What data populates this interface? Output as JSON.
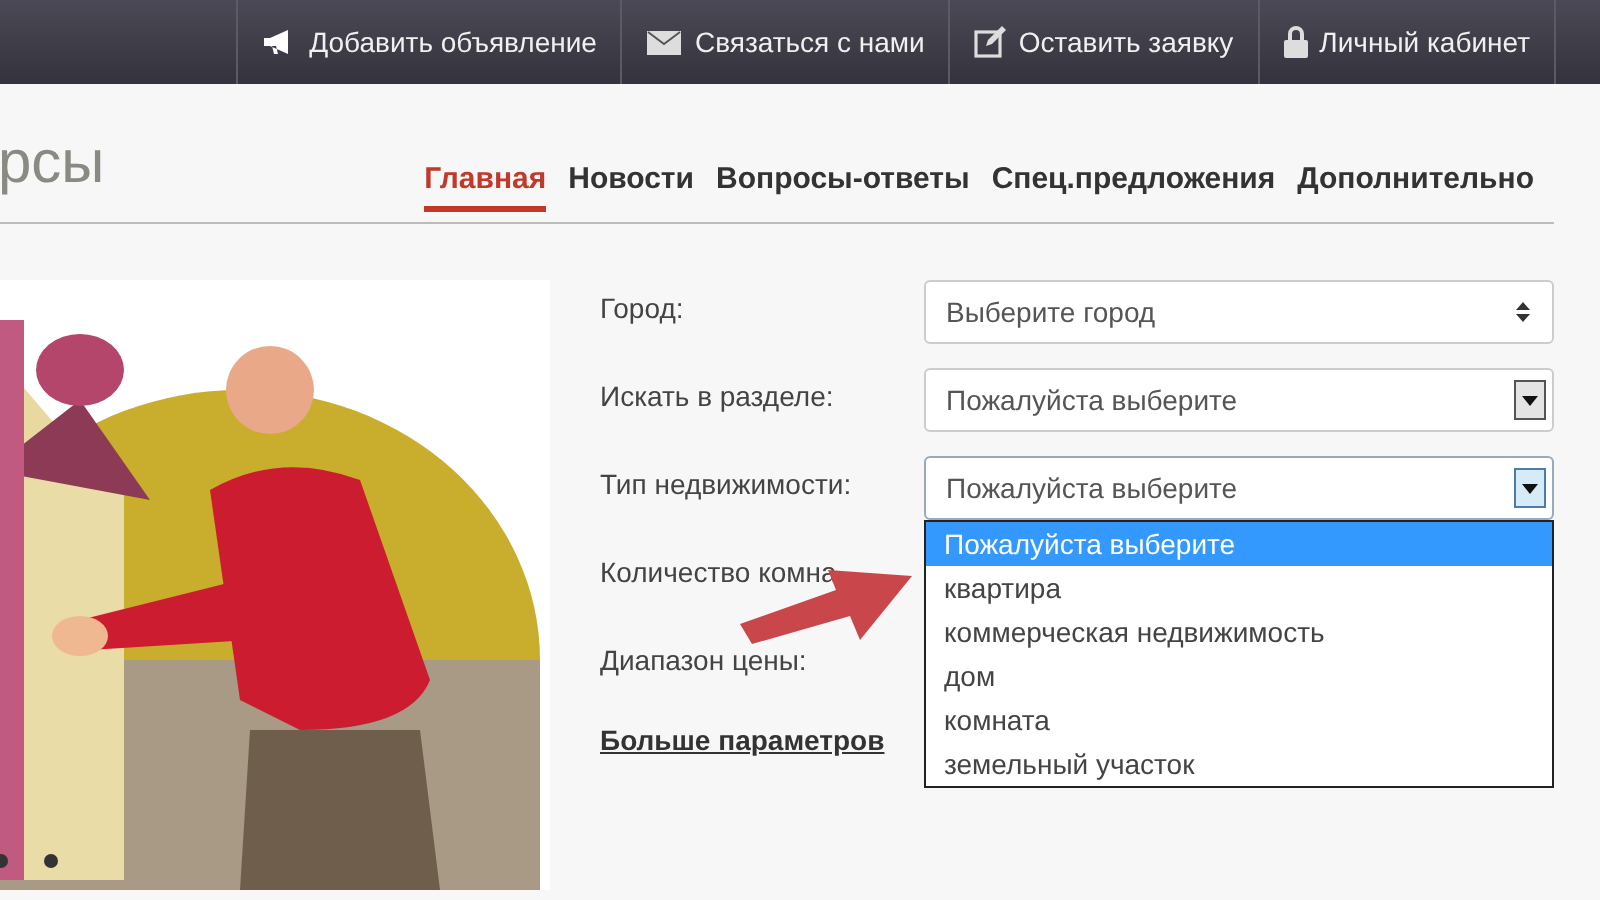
{
  "top_bar": {
    "items": [
      {
        "kind": "megaphone",
        "label": "Добавить объявление"
      },
      {
        "kind": "envelope",
        "label": "Связаться с нами"
      },
      {
        "kind": "edit",
        "label": "Оставить заявку"
      },
      {
        "kind": "lock",
        "label": "Личный кабинет"
      }
    ]
  },
  "logo": {
    "text": "рсы"
  },
  "nav": {
    "tabs": [
      {
        "label": "Главная",
        "selected": true
      },
      {
        "label": "Новости",
        "selected": false
      },
      {
        "label": "Вопросы-ответы",
        "selected": false
      },
      {
        "label": "Спец.предложения",
        "selected": false
      },
      {
        "label": "Дополнительно",
        "selected": false
      }
    ]
  },
  "form": {
    "fields": [
      {
        "label": "Город:",
        "select": {
          "value": "Выберите город",
          "kind": "updown",
          "open": false
        }
      },
      {
        "label": "Искать в разделе:",
        "select": {
          "value": "Пожалуйста выберите",
          "kind": "box",
          "open": false
        }
      },
      {
        "label": "Тип недвижимости:",
        "select": {
          "value": "Пожалуйста выберите",
          "kind": "box",
          "open": true
        }
      },
      {
        "label": "Количество комна"
      },
      {
        "label": "Диапазон цены:"
      }
    ],
    "more_link": "Больше параметров",
    "dropdown_options": [
      {
        "label": "Пожалуйста выберите",
        "selected": true
      },
      {
        "label": "квартира",
        "selected": false
      },
      {
        "label": "коммерческая недвижимость",
        "selected": false
      },
      {
        "label": "дом",
        "selected": false
      },
      {
        "label": "комната",
        "selected": false
      },
      {
        "label": "земельный участок",
        "selected": false
      }
    ]
  }
}
